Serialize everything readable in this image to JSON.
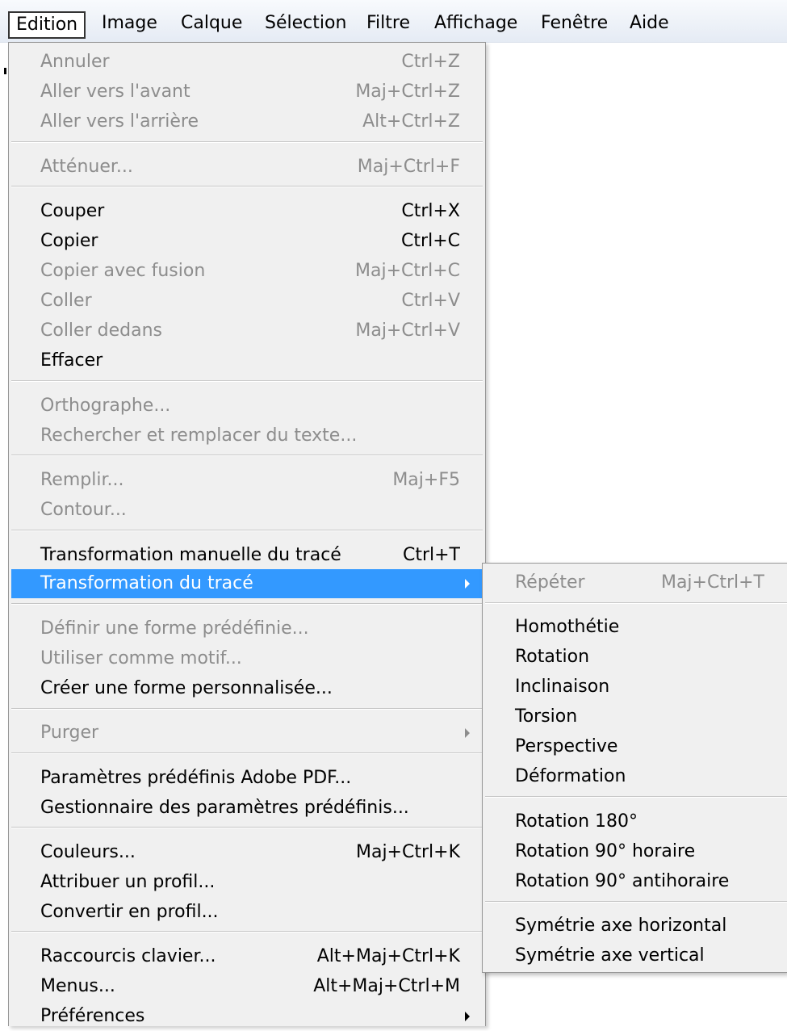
{
  "menubar": {
    "items": [
      "Edition",
      "Image",
      "Calque",
      "Sélection",
      "Filtre",
      "Affichage",
      "Fenêtre",
      "Aide"
    ]
  },
  "edit_menu": {
    "items": [
      {
        "label": "Annuler",
        "shortcut": "Ctrl+Z",
        "enabled": false
      },
      {
        "label": "Aller vers l'avant",
        "shortcut": "Maj+Ctrl+Z",
        "enabled": false
      },
      {
        "label": "Aller vers l'arrière",
        "shortcut": "Alt+Ctrl+Z",
        "enabled": false
      },
      {
        "label": "Atténuer...",
        "shortcut": "Maj+Ctrl+F",
        "enabled": false
      },
      {
        "label": "Couper",
        "shortcut": "Ctrl+X",
        "enabled": true
      },
      {
        "label": "Copier",
        "shortcut": "Ctrl+C",
        "enabled": true
      },
      {
        "label": "Copier avec fusion",
        "shortcut": "Maj+Ctrl+C",
        "enabled": false
      },
      {
        "label": "Coller",
        "shortcut": "Ctrl+V",
        "enabled": false
      },
      {
        "label": "Coller dedans",
        "shortcut": "Maj+Ctrl+V",
        "enabled": false
      },
      {
        "label": "Effacer",
        "shortcut": "",
        "enabled": true
      },
      {
        "label": "Orthographe...",
        "shortcut": "",
        "enabled": false
      },
      {
        "label": "Rechercher et remplacer du texte...",
        "shortcut": "",
        "enabled": false
      },
      {
        "label": "Remplir...",
        "shortcut": "Maj+F5",
        "enabled": false
      },
      {
        "label": "Contour...",
        "shortcut": "",
        "enabled": false
      },
      {
        "label": "Transformation manuelle du tracé",
        "shortcut": "Ctrl+T",
        "enabled": true
      },
      {
        "label": "Transformation du tracé",
        "shortcut": "",
        "enabled": true,
        "submenu": true,
        "highlighted": true
      },
      {
        "label": "Définir une forme prédéfinie...",
        "shortcut": "",
        "enabled": false
      },
      {
        "label": "Utiliser comme motif...",
        "shortcut": "",
        "enabled": false
      },
      {
        "label": "Créer une forme personnalisée...",
        "shortcut": "",
        "enabled": true
      },
      {
        "label": "Purger",
        "shortcut": "",
        "enabled": false,
        "submenu": true
      },
      {
        "label": "Paramètres prédéfinis Adobe PDF...",
        "shortcut": "",
        "enabled": true
      },
      {
        "label": "Gestionnaire des paramètres prédéfinis...",
        "shortcut": "",
        "enabled": true
      },
      {
        "label": "Couleurs...",
        "shortcut": "Maj+Ctrl+K",
        "enabled": true
      },
      {
        "label": "Attribuer un profil...",
        "shortcut": "",
        "enabled": true
      },
      {
        "label": "Convertir en profil...",
        "shortcut": "",
        "enabled": true
      },
      {
        "label": "Raccourcis clavier...",
        "shortcut": "Alt+Maj+Ctrl+K",
        "enabled": true
      },
      {
        "label": "Menus...",
        "shortcut": "Alt+Maj+Ctrl+M",
        "enabled": true
      },
      {
        "label": "Préférences",
        "shortcut": "",
        "enabled": true,
        "submenu": true
      }
    ]
  },
  "transform_submenu": {
    "items": [
      {
        "label": "Répéter",
        "shortcut": "Maj+Ctrl+T",
        "enabled": false
      },
      {
        "label": "Homothétie",
        "shortcut": "",
        "enabled": true
      },
      {
        "label": "Rotation",
        "shortcut": "",
        "enabled": true
      },
      {
        "label": "Inclinaison",
        "shortcut": "",
        "enabled": true
      },
      {
        "label": "Torsion",
        "shortcut": "",
        "enabled": true
      },
      {
        "label": "Perspective",
        "shortcut": "",
        "enabled": true
      },
      {
        "label": "Déformation",
        "shortcut": "",
        "enabled": true
      },
      {
        "label": "Rotation 180°",
        "shortcut": "",
        "enabled": true
      },
      {
        "label": "Rotation 90° horaire",
        "shortcut": "",
        "enabled": true
      },
      {
        "label": "Rotation 90° antihoraire",
        "shortcut": "",
        "enabled": true
      },
      {
        "label": "Symétrie axe horizontal",
        "shortcut": "",
        "enabled": true
      },
      {
        "label": "Symétrie axe vertical",
        "shortcut": "",
        "enabled": true
      }
    ]
  },
  "colors": {
    "highlight": "#3399ff",
    "disabled_text": "#8d8d8d",
    "menu_background": "#f0f0f0"
  }
}
